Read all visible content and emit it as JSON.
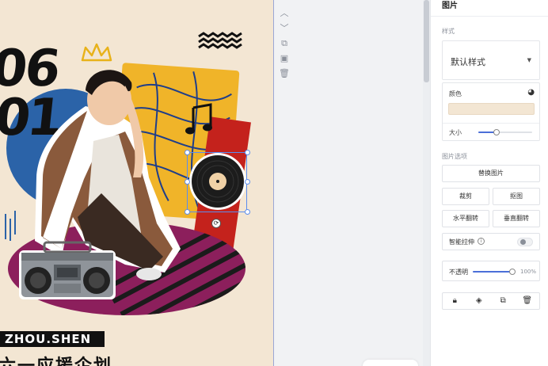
{
  "canvas": {
    "poster_num_top": "06",
    "poster_num_bottom": "01",
    "name_tag": "ZHOU.SHEN",
    "bottom_text": "六一应援企划"
  },
  "panel": {
    "title": "图片",
    "style_section": "样式",
    "style_select_value": "默认样式",
    "color_label": "颜色",
    "color_value": "#f3e6d3",
    "size_label": "大小",
    "size_value": 0.34,
    "image_options_section": "图片选项",
    "replace_button": "替换图片",
    "crop_button": "裁剪",
    "cutout_button": "抠图",
    "flip_h_button": "水平翻转",
    "flip_v_button": "垂直翻转",
    "smart_stretch_label": "智能拉伸",
    "opacity_label": "不透明",
    "opacity_value": "100%"
  },
  "colors": {
    "accent": "#4b6fd8",
    "poster_bg": "#f3e6d3",
    "blue": "#2b63a8",
    "yellow": "#f0b429",
    "red": "#c4221c",
    "purple": "#8c1f5c"
  }
}
